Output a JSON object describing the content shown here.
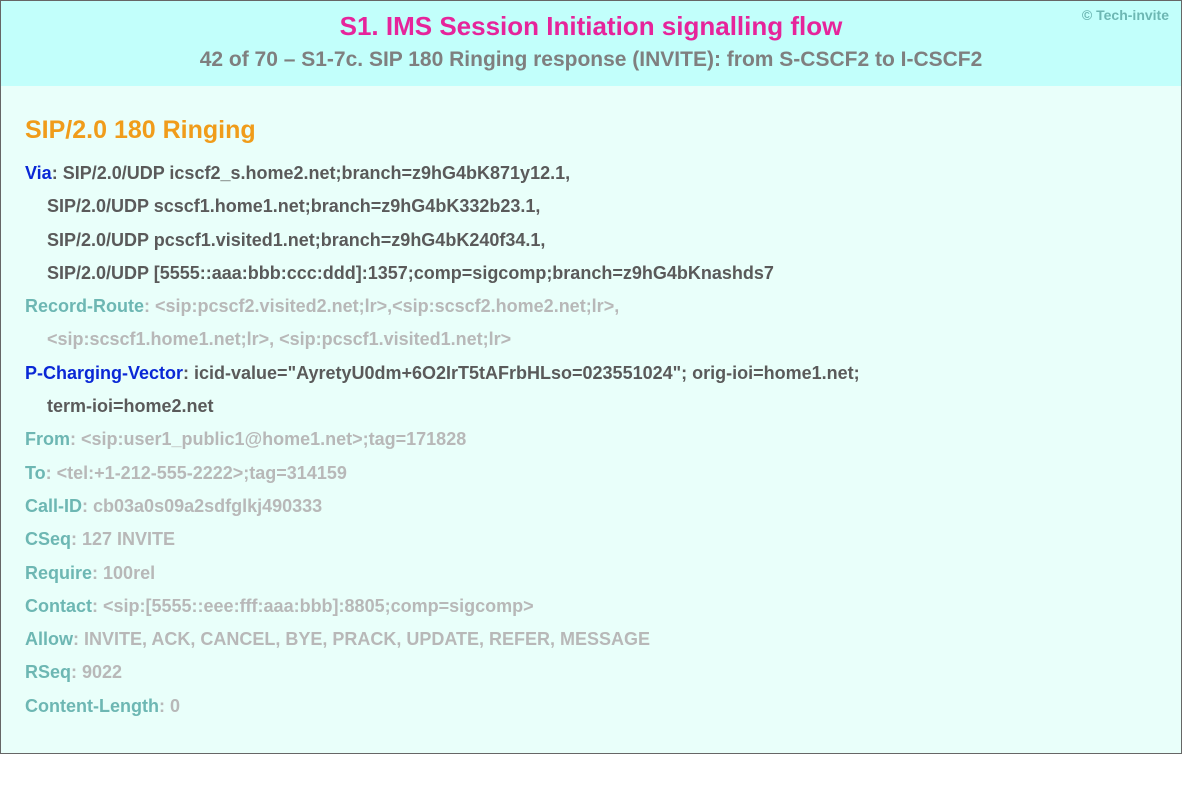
{
  "credit": "© Tech-invite",
  "title": "S1. IMS Session Initiation signalling flow",
  "subtitle": "42 of 70 – S1-7c. SIP 180 Ringing response (INVITE): from S-CSCF2 to I-CSCF2",
  "status_line": "SIP/2.0 180 Ringing",
  "headers": {
    "via": {
      "name": "Via",
      "l1": "SIP/2.0/UDP icscf2_s.home2.net;branch=z9hG4bK871y12.1,",
      "l2": "SIP/2.0/UDP scscf1.home1.net;branch=z9hG4bK332b23.1,",
      "l3": "SIP/2.0/UDP pcscf1.visited1.net;branch=z9hG4bK240f34.1,",
      "l4": "SIP/2.0/UDP [5555::aaa:bbb:ccc:ddd]:1357;comp=sigcomp;branch=z9hG4bKnashds7"
    },
    "record_route": {
      "name": "Record-Route",
      "l1": "<sip:pcscf2.visited2.net;lr>,<sip:scscf2.home2.net;lr>,",
      "l2": "<sip:scscf1.home1.net;lr>, <sip:pcscf1.visited1.net;lr>"
    },
    "p_charging_vector": {
      "name": "P-Charging-Vector",
      "l1": "icid-value=\"AyretyU0dm+6O2IrT5tAFrbHLso=023551024\"; orig-ioi=home1.net;",
      "l2": "term-ioi=home2.net"
    },
    "from": {
      "name": "From",
      "value": "<sip:user1_public1@home1.net>;tag=171828"
    },
    "to": {
      "name": "To",
      "value": "<tel:+1-212-555-2222>;tag=314159"
    },
    "call_id": {
      "name": "Call-ID",
      "value": "cb03a0s09a2sdfglkj490333"
    },
    "cseq": {
      "name": "CSeq",
      "value": "127 INVITE"
    },
    "require": {
      "name": "Require",
      "value": "100rel"
    },
    "contact": {
      "name": "Contact",
      "value": "<sip:[5555::eee:fff:aaa:bbb]:8805;comp=sigcomp>"
    },
    "allow": {
      "name": "Allow",
      "value": "INVITE, ACK, CANCEL, BYE, PRACK, UPDATE, REFER, MESSAGE"
    },
    "rseq": {
      "name": "RSeq",
      "value": "9022"
    },
    "content_length": {
      "name": "Content-Length",
      "value": "0"
    }
  }
}
